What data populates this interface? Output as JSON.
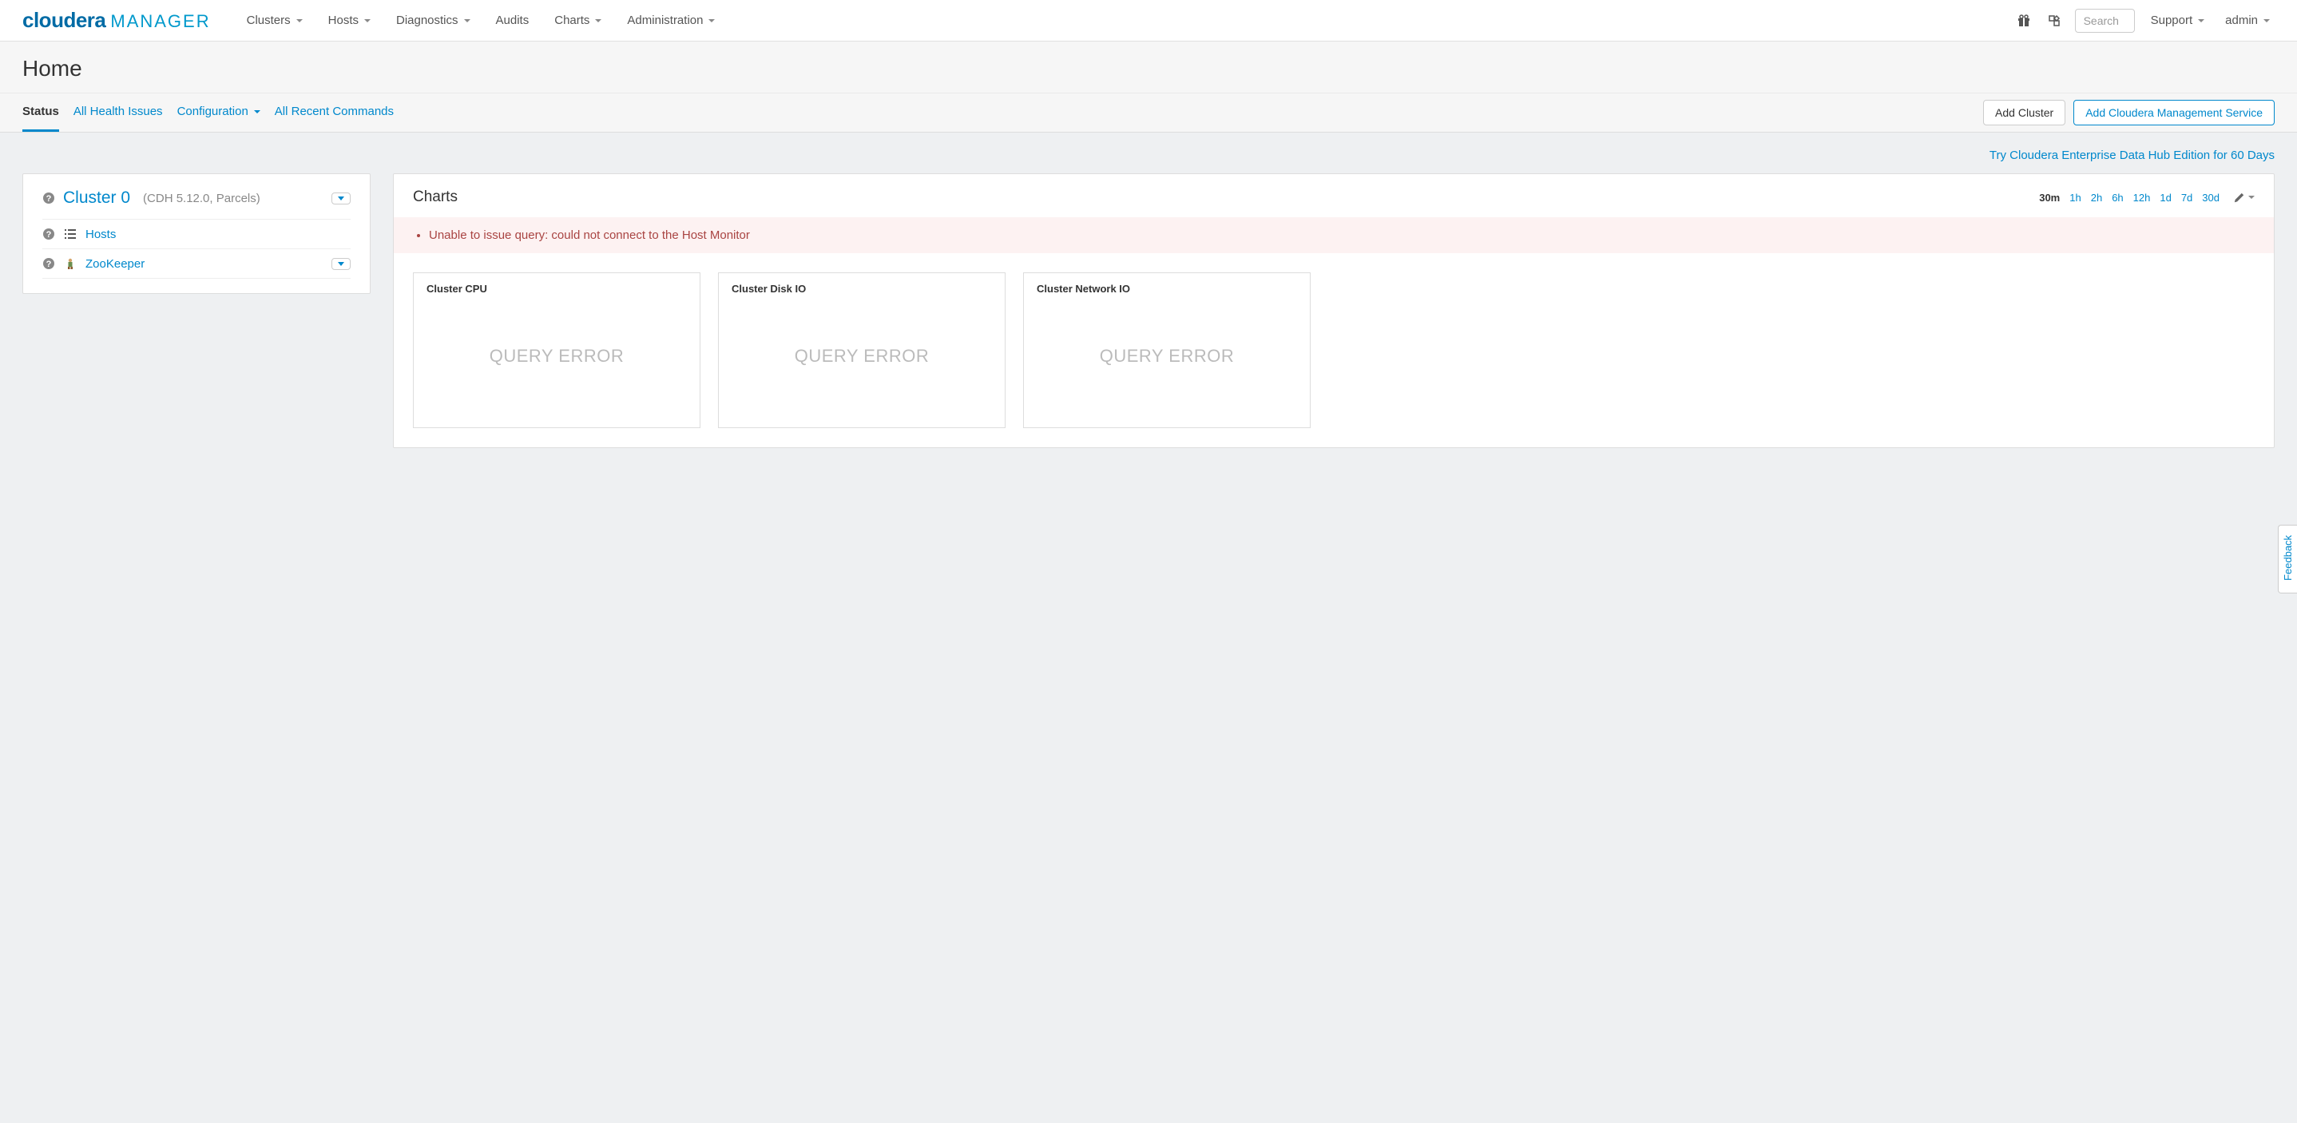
{
  "brand": {
    "cloudera": "cloudera",
    "manager": "MANAGER"
  },
  "topnav": {
    "items": [
      {
        "label": "Clusters",
        "dropdown": true
      },
      {
        "label": "Hosts",
        "dropdown": true
      },
      {
        "label": "Diagnostics",
        "dropdown": true
      },
      {
        "label": "Audits",
        "dropdown": false
      },
      {
        "label": "Charts",
        "dropdown": true
      },
      {
        "label": "Administration",
        "dropdown": true
      }
    ],
    "search_placeholder": "Search",
    "support": "Support",
    "user": "admin"
  },
  "page": {
    "title": "Home"
  },
  "tabs": {
    "items": [
      {
        "label": "Status",
        "active": true
      },
      {
        "label": "All Health Issues",
        "active": false
      },
      {
        "label": "Configuration",
        "active": false,
        "dropdown": true
      },
      {
        "label": "All Recent Commands",
        "active": false
      }
    ],
    "actions": {
      "add_cluster": "Add Cluster",
      "add_mgmt": "Add Cloudera Management Service"
    }
  },
  "trial": {
    "link": "Try Cloudera Enterprise Data Hub Edition for 60 Days"
  },
  "cluster": {
    "name": "Cluster 0",
    "meta": "(CDH 5.12.0, Parcels)",
    "services": [
      {
        "label": "Hosts",
        "icon": "list"
      },
      {
        "label": "ZooKeeper",
        "icon": "zookeeper",
        "dropdown": true
      }
    ]
  },
  "charts": {
    "title": "Charts",
    "time_ranges": [
      "30m",
      "1h",
      "2h",
      "6h",
      "12h",
      "1d",
      "7d",
      "30d"
    ],
    "active_range": "30m",
    "error": "Unable to issue query: could not connect to the Host Monitor",
    "cards": [
      {
        "title": "Cluster CPU",
        "body": "QUERY ERROR"
      },
      {
        "title": "Cluster Disk IO",
        "body": "QUERY ERROR"
      },
      {
        "title": "Cluster Network IO",
        "body": "QUERY ERROR"
      }
    ]
  },
  "feedback": "Feedback"
}
